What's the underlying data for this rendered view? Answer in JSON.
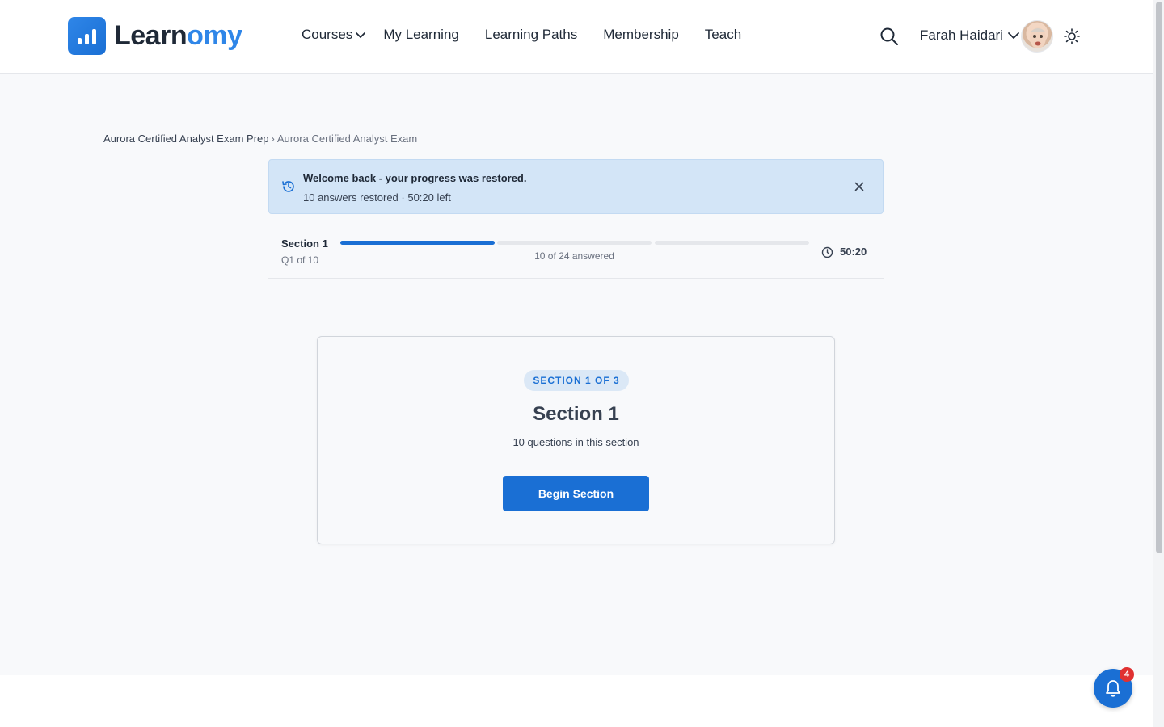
{
  "brand": {
    "name_part1": "Learn",
    "name_part2": "omy",
    "accent": "#1a6fd4"
  },
  "nav": {
    "courses": "Courses",
    "my_learning": "My Learning",
    "learning_paths": "Learning Paths",
    "membership": "Membership",
    "teach": "Teach"
  },
  "user": {
    "name": "Farah Haidari"
  },
  "breadcrumb": {
    "parent": "Aurora Certified Analyst Exam Prep",
    "separator": "›",
    "current": "Aurora Certified Analyst Exam"
  },
  "alert": {
    "title": "Welcome back - your progress was restored.",
    "subtitle": "10 answers restored · 50:20 left"
  },
  "progress": {
    "section_label": "Section 1",
    "question_label": "Q1 of 10",
    "answered_text": "10 of 24 answered",
    "timer": "50:20",
    "segments": [
      1.0,
      0,
      0
    ]
  },
  "card": {
    "badge": "SECTION 1 OF 3",
    "title": "Section 1",
    "subtitle": "10 questions in this section",
    "button": "Begin Section"
  },
  "notifications": {
    "count": "4"
  }
}
